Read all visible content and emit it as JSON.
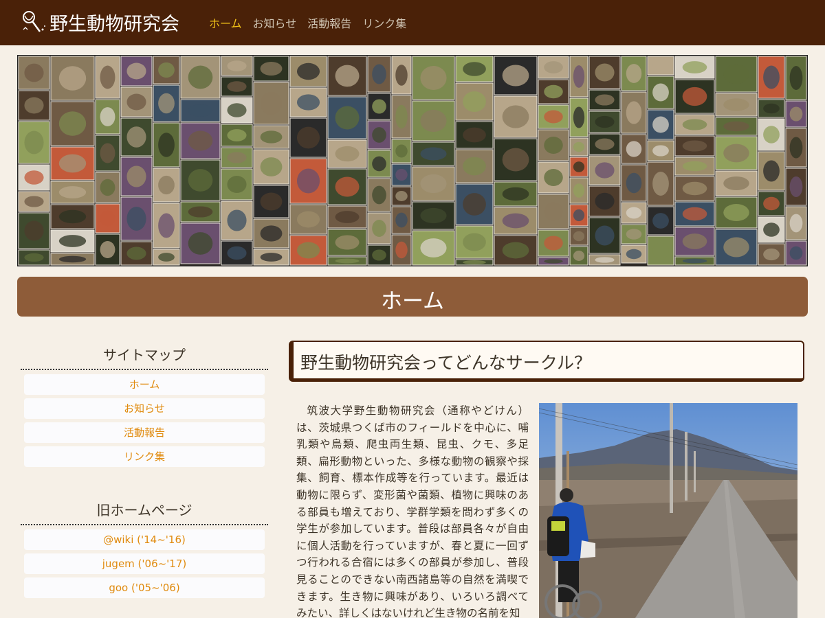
{
  "header": {
    "site_title": "野生動物研究会",
    "logo_icon": "bug-net-icon",
    "nav": [
      {
        "label": "ホーム",
        "active": true
      },
      {
        "label": "お知らせ",
        "active": false
      },
      {
        "label": "活動報告",
        "active": false
      },
      {
        "label": "リンク集",
        "active": false
      }
    ]
  },
  "banner": {
    "description_icon": "wildlife-photo-mosaic"
  },
  "page_heading": "ホーム",
  "sidebar": {
    "sitemap_title": "サイトマップ",
    "sitemap_items": [
      "ホーム",
      "お知らせ",
      "活動報告",
      "リンク集"
    ],
    "old_title": "旧ホームページ",
    "old_items": [
      "@wiki ('14~'16)",
      "jugem ('06~'17)",
      "goo ('05~'06)"
    ]
  },
  "main": {
    "heading": "野生動物研究会ってどんなサークル？",
    "body": "筑波大学野生動物研究会（通称やどけん）は、茨城県つくば市のフィールドを中心に、哺乳類や鳥類、爬虫両生類、昆虫、クモ、多足類、扁形動物といった、多様な動物の観察や採集、飼育、標本作成等を行っています。最近は動物に限らず、変形菌や菌類、植物に興味のある部員も増えており、学群学類を問わず多くの学生が参加しています。普段は部員各々が自由に個人活動を行っていますが、春と夏に一回ずつ行われる合宿には多くの部員が参加し、普段見ることのできない南西諸島等の自然を満喫できます。生き物に興味があり、いろいろ調べてみたい、詳しくはないけれど生き物の名前を知"
  },
  "colors": {
    "header_bg": "#4a2108",
    "nav_active": "#f2c318",
    "heading_bg": "#8e5c39",
    "link_orange": "#e08a0d",
    "page_bg": "#f6f0e7"
  }
}
